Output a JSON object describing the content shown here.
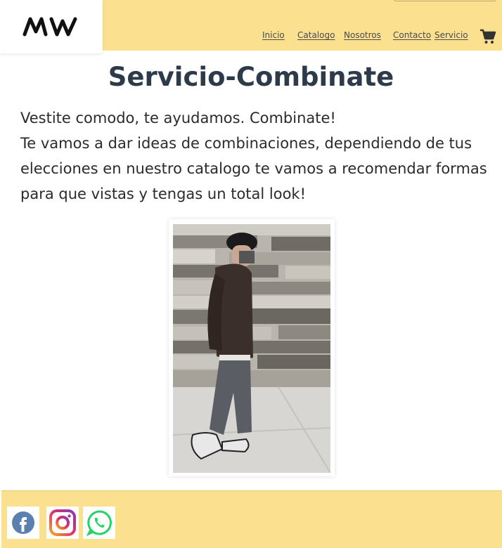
{
  "header": {
    "logo": "MW",
    "nav": [
      {
        "label": "Inicio"
      },
      {
        "label": "Catalogo"
      },
      {
        "label": "Nosotros"
      },
      {
        "label": "Contacto"
      },
      {
        "label": "Servicio"
      }
    ],
    "cart_icon": "shopping-cart-icon"
  },
  "main": {
    "title": "Servicio-Combinate",
    "lines": [
      "Vestite comodo, te ayudamos. Combinate!",
      "Te vamos a dar ideas de combinaciones, dependiendo de tus elecciones en nuestro catalogo te vamos a recomendar formas para que vistas y tengas un total look!"
    ],
    "image": "outfit-photo"
  },
  "footer": {
    "social": [
      "facebook-icon",
      "instagram-icon",
      "whatsapp-icon"
    ]
  },
  "colors": {
    "header_bg": "#fbe08f",
    "title": "#2c3a4a",
    "text": "#2b2b2b"
  }
}
